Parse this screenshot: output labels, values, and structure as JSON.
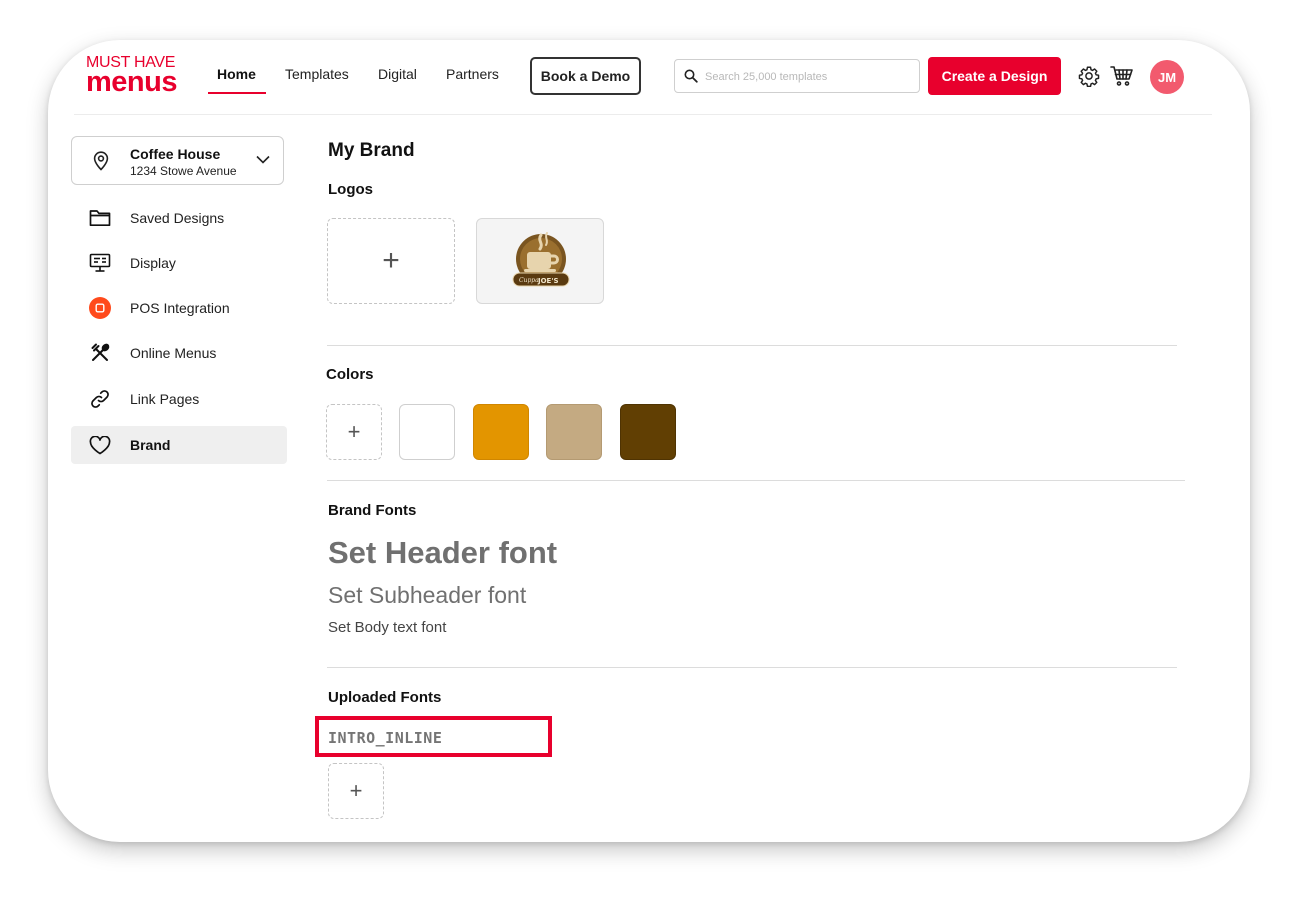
{
  "logo": {
    "line1": "MUST HAVE",
    "line2": "menus"
  },
  "nav": {
    "home": "Home",
    "templates": "Templates",
    "digital": "Digital",
    "partners": "Partners",
    "book_demo": "Book a Demo",
    "search_placeholder": "Search 25,000 templates",
    "create_design": "Create a Design",
    "settings_icon": "gear-icon",
    "cart_icon": "cart-icon",
    "avatar_initials": "JM",
    "accent_color": "#e8002d"
  },
  "location": {
    "name": "Coffee House",
    "address": "1234 Stowe Avenue"
  },
  "sidebar": {
    "items": [
      {
        "label": "Saved Designs",
        "icon": "folder-icon"
      },
      {
        "label": "Display",
        "icon": "monitor-icon"
      },
      {
        "label": "POS Integration",
        "icon": "pos-icon"
      },
      {
        "label": "Online Menus",
        "icon": "utensils-icon"
      },
      {
        "label": "Link Pages",
        "icon": "link-icon"
      },
      {
        "label": "Brand",
        "icon": "heart-icon",
        "active": true
      }
    ]
  },
  "main": {
    "title": "My Brand",
    "logos_heading": "Logos",
    "logo_text": {
      "top": "Cuppa",
      "bottom": "JOE'S"
    },
    "colors_heading": "Colors",
    "colors": [
      "#ffffff",
      "#e39500",
      "#c4aa82",
      "#613f03"
    ],
    "brand_fonts_heading": "Brand Fonts",
    "header_font": "Set Header font",
    "subheader_font": "Set Subheader font",
    "body_font": "Set Body text font",
    "uploaded_fonts_heading": "Uploaded Fonts",
    "uploaded_font_name": "INTRO_INLINE",
    "add_symbol": "+"
  }
}
